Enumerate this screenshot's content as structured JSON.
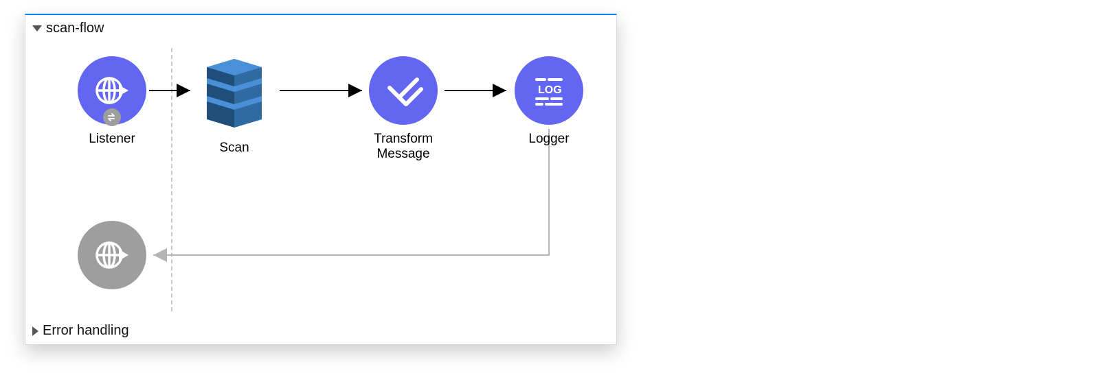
{
  "flow": {
    "title": "scan-flow",
    "errorSection": "Error handling",
    "nodes": {
      "listener": {
        "label": "Listener"
      },
      "scan": {
        "label": "Scan"
      },
      "transform": {
        "label": "Transform\nMessage"
      },
      "logger": {
        "label": "Logger"
      }
    }
  }
}
